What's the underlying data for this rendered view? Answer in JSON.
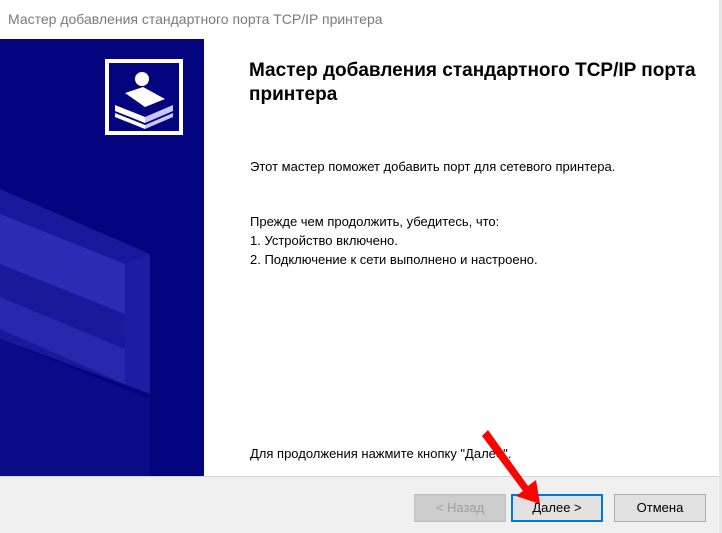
{
  "window": {
    "title": "Мастер добавления стандартного порта TCP/IP принтера"
  },
  "banner": {
    "background": "#04047f"
  },
  "content": {
    "heading": "Мастер добавления стандартного TCP/IP порта принтера",
    "intro": "Этот мастер поможет добавить порт для сетевого принтера.",
    "checklist_lines": [
      "Прежде чем продолжить, убедитесь, что:",
      "1.  Устройство включено.",
      "2.  Подключение к сети выполнено и настроено."
    ],
    "continue_hint": "Для продолжения нажмите кнопку \"Далее\"."
  },
  "buttons": {
    "back_label": "< Назад",
    "next_label": "Далее >",
    "cancel_label": "Отмена"
  },
  "annotation": {
    "arrow_color": "#ff0000"
  }
}
